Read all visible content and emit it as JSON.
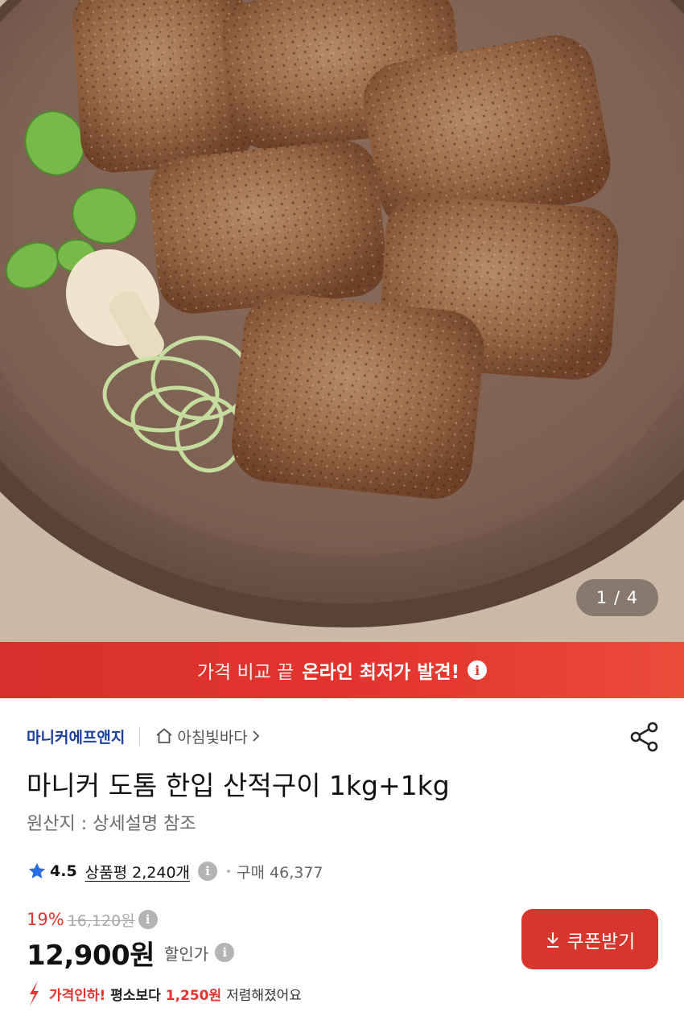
{
  "gallery": {
    "current_page": 1,
    "total_pages": 4,
    "indicator": "1 / 4"
  },
  "promo_banner": {
    "prefix": "가격 비교 끝",
    "highlight": "온라인 최저가 발견!",
    "info_glyph": "i",
    "background": "#e2352f"
  },
  "seller": {
    "brand": "마니커에프앤지",
    "store": "아침빛바다",
    "store_icon": "home-icon",
    "store_chevron": "chevron-right-icon"
  },
  "product": {
    "title": "마니커 도톰 한입 산적구이 1kg+1kg",
    "origin": "원산지 : 상세설명 참조"
  },
  "rating": {
    "icon": "star-icon",
    "score": "4.5",
    "reviews": "상품평 2,240개",
    "info_glyph": "i",
    "purchases": "구매 46,377"
  },
  "price": {
    "discount_rate": "19%",
    "original": "16,120원",
    "current": "12,900원",
    "label": "할인가",
    "info_glyph": "i"
  },
  "price_drop": {
    "icon": "price-down-arrow-icon",
    "prefix": "가격인하!",
    "middle": "평소보다",
    "amount": "1,250원",
    "suffix": "저렴해졌어요"
  },
  "coupon": {
    "label": "쿠폰받기",
    "icon": "download-icon"
  },
  "colors": {
    "accent": "#e2352f",
    "brand_link": "#1a3fa0",
    "star": "#2b6de8"
  }
}
